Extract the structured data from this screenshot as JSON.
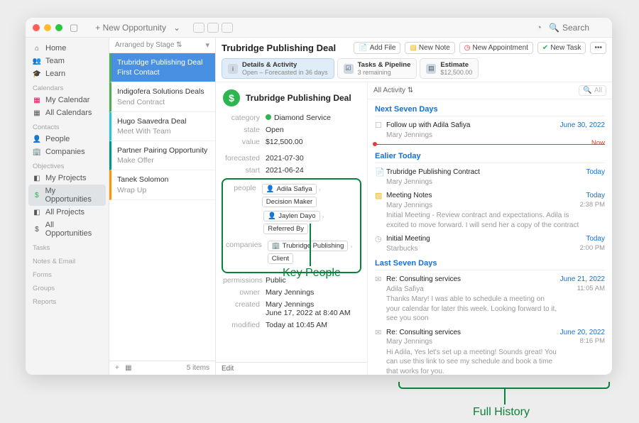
{
  "titlebar": {
    "new_opportunity": "+ New Opportunity",
    "search_placeholder": "Search"
  },
  "sidebar": {
    "home": "Home",
    "team": "Team",
    "learn": "Learn",
    "head_cal": "Calendars",
    "my_calendar": "My Calendar",
    "all_calendars": "All Calendars",
    "head_contacts": "Contacts",
    "people": "People",
    "companies": "Companies",
    "head_obj": "Objectives",
    "my_projects": "My Projects",
    "my_opportunities": "My Opportunities",
    "all_projects": "All Projects",
    "all_opportunities": "All Opportunities",
    "head_tasks": "Tasks",
    "notes_email": "Notes & Email",
    "forms": "Forms",
    "groups": "Groups",
    "reports": "Reports"
  },
  "listcol": {
    "arranged": "Arranged by Stage",
    "footer_count": "5 items",
    "cards": [
      {
        "t": "Trubridge Publishing Deal",
        "s": "First Contact"
      },
      {
        "t": "Indigofera Solutions Deals",
        "s": "Send Contract"
      },
      {
        "t": "Hugo Saavedra Deal",
        "s": "Meet With Team"
      },
      {
        "t": "Partner Pairing Opportunity",
        "s": "Make Offer"
      },
      {
        "t": "Tanek Solomon",
        "s": "Wrap Up"
      }
    ]
  },
  "detail": {
    "title": "Trubridge Publishing Deal",
    "actions": {
      "add_file": "Add File",
      "new_note": "New Note",
      "new_appt": "New Appointment",
      "new_task": "New Task"
    },
    "subtabs": {
      "details_lbl": "Details & Activity",
      "details_sub": "Open – Forecasted in 36 days",
      "tasks_lbl": "Tasks & Pipeline",
      "tasks_sub": "3 remaining",
      "est_lbl": "Estimate",
      "est_sub": "$12,500.00"
    },
    "deal_title": "Trubridge Publishing Deal",
    "fields": {
      "category_k": "category",
      "category_v": "Diamond Service",
      "state_k": "state",
      "state_v": "Open",
      "value_k": "value",
      "value_v": "$12,500.00",
      "forecasted_k": "forecasted",
      "forecasted_v": "2021-07-30",
      "start_k": "start",
      "start_v": "2021-06-24",
      "people_k": "people",
      "person1_name": "Adila Safiya",
      "person1_role": "Decision Maker",
      "person2_name": "Jaylen Dayo",
      "person2_role": "Referred By",
      "companies_k": "companies",
      "company1_name": "Trubridge Publishing",
      "company1_role": "Client",
      "perm_k": "permissions",
      "perm_v": "Public",
      "owner_k": "owner",
      "owner_v": "Mary Jennings",
      "created_k": "created",
      "created_v": "Mary Jennings",
      "created_v2": "June 17, 2022 at 8:40 AM",
      "modified_k": "modified",
      "modified_v": "Today at 10:45 AM"
    },
    "edit_label": "Edit"
  },
  "activity": {
    "filter": "All Activity",
    "search_ph": "All",
    "next7": "Next Seven Days",
    "now": "Now",
    "earlier": "Ealier Today",
    "last7": "Last Seven Days",
    "items": {
      "followup_t": "Follow up with Adila Safiya",
      "followup_who": "Mary Jennings",
      "followup_date": "June 30, 2022",
      "contract_t": "Trubridge Publishing Contract",
      "contract_who": "Mary Jennings",
      "contract_date": "Today",
      "notes_t": "Meeting Notes",
      "notes_who": "Mary Jennings",
      "notes_date": "Today",
      "notes_time": "2:38 PM",
      "notes_desc": "Initial Meeting - Review contract and expectations. Adila is excited to move forward. I will send her a copy of the contract",
      "meeting_t": "Initial Meeting",
      "meeting_loc": "Starbucks",
      "meeting_date": "Today",
      "meeting_time": "2:00 PM",
      "re1_t": "Re: Consulting services",
      "re1_who": "Adila Safiya",
      "re1_date": "June 21, 2022",
      "re1_time": "11:05 AM",
      "re1_desc": "Thanks Mary! I was able to schedule a meeting on your calendar for later this week. Looking forward to it, see you soon",
      "re2_t": "Re: Consulting services",
      "re2_who": "Mary Jennings",
      "re2_date": "June 20, 2022",
      "re2_time": "8:16 PM",
      "re2_desc": "Hi Adila, Yes let's set up a meeting! Sounds great! You can use this link to see my schedule and book a time that works for you."
    }
  },
  "annotations": {
    "key_people": "Key People",
    "full_history": "Full History"
  }
}
